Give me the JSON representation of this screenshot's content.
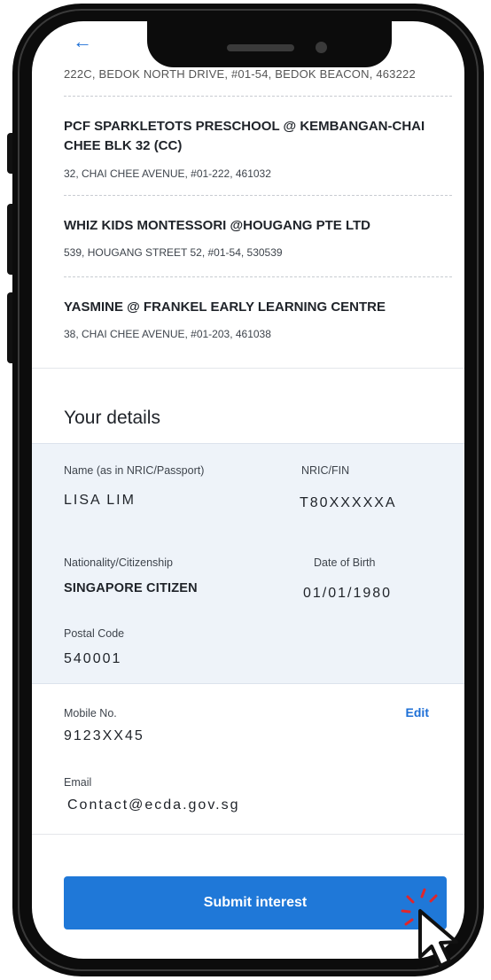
{
  "nav": {
    "back_glyph": "←",
    "back_icon": "arrow-left-icon"
  },
  "centres": {
    "cut_address": "222C, BEDOK NORTH DRIVE, #01-54, BEDOK BEACON, 463222",
    "items": [
      {
        "name": "PCF SPARKLETOTS PRESCHOOL @ KEMBANGAN-CHAI CHEE BLK 32 (CC)",
        "address": "32, CHAI CHEE AVENUE, #01-222, 461032"
      },
      {
        "name": "WHIZ KIDS MONTESSORI @HOUGANG PTE LTD",
        "address": "539, HOUGANG STREET 52, #01-54, 530539"
      },
      {
        "name": "YASMINE @ FRANKEL EARLY LEARNING CENTRE",
        "address": "38, CHAI CHEE AVENUE, #01-203, 461038"
      }
    ]
  },
  "details": {
    "title": "Your details",
    "name_label": "Name (as in NRIC/Passport)",
    "name_value": "LISA LIM",
    "nric_label": "NRIC/FIN",
    "nric_value": "T80XXXXXA",
    "nationality_label": "Nationality/Citizenship",
    "nationality_value": "SINGAPORE CITIZEN",
    "dob_label": "Date of Birth",
    "dob_value": "01/01/1980",
    "postal_label": "Postal Code",
    "postal_value": "540001",
    "mobile_label": "Mobile No.",
    "mobile_value": "9123XX45",
    "edit_label": "Edit",
    "email_label": "Email",
    "email_value": "Contact@ecda.gov.sg"
  },
  "actions": {
    "submit_label": "Submit interest"
  },
  "colors": {
    "accent": "#1f78d8",
    "link": "#1d6fd6",
    "panel_bg": "#eef3f9",
    "cursor_click": "#e0262b"
  }
}
